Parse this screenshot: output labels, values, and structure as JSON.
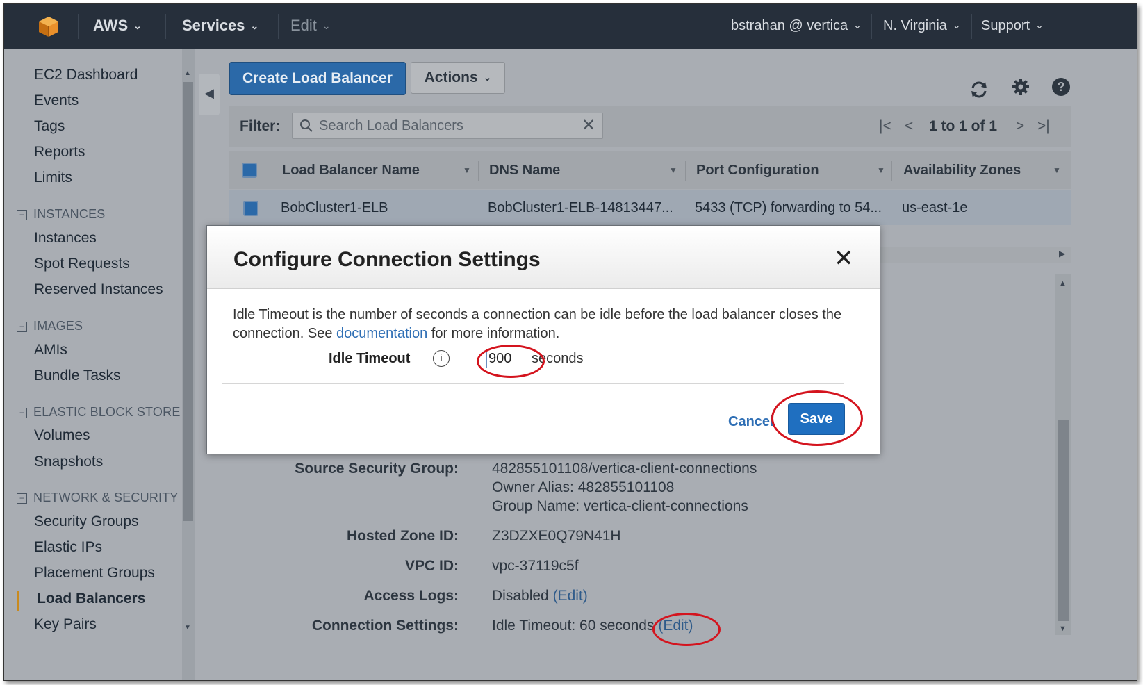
{
  "topnav": {
    "brand": "AWS",
    "services": "Services",
    "edit": "Edit",
    "account": "bstrahan @ vertica",
    "region": "N. Virginia",
    "support": "Support",
    "caret": "⌄"
  },
  "sidebar": {
    "links_top": [
      "EC2 Dashboard",
      "Events",
      "Tags",
      "Reports",
      "Limits"
    ],
    "sections": [
      {
        "title": "INSTANCES",
        "items": [
          "Instances",
          "Spot Requests",
          "Reserved Instances"
        ]
      },
      {
        "title": "IMAGES",
        "items": [
          "AMIs",
          "Bundle Tasks"
        ]
      },
      {
        "title": "ELASTIC BLOCK STORE",
        "items": [
          "Volumes",
          "Snapshots"
        ]
      },
      {
        "title": "NETWORK & SECURITY",
        "items": [
          "Security Groups",
          "Elastic IPs",
          "Placement Groups",
          "Load Balancers",
          "Key Pairs"
        ]
      }
    ],
    "active": "Load Balancers",
    "collapse_glyph": "−"
  },
  "toolbar": {
    "create_label": "Create Load Balancer",
    "actions_label": "Actions",
    "icons": [
      "refresh-icon",
      "gear-icon",
      "help-icon"
    ]
  },
  "filter": {
    "label": "Filter:",
    "placeholder": "Search Load Balancers",
    "pager_text": "1 to 1 of 1"
  },
  "table": {
    "columns": [
      "Load Balancer Name",
      "DNS Name",
      "Port Configuration",
      "Availability Zones"
    ],
    "rows": [
      {
        "name": "BobCluster1-ELB",
        "dns": "BobCluster1-ELB-14813447...",
        "port": "5433 (TCP) forwarding to 54...",
        "zones": "us-east-1e"
      }
    ]
  },
  "details": {
    "source_sg_label": "Source Security Group:",
    "source_sg_lines": [
      "482855101108/vertica-client-connections",
      "Owner Alias: 482855101108",
      "Group Name: vertica-client-connections"
    ],
    "hosted_zone_label": "Hosted Zone ID:",
    "hosted_zone_value": "Z3DZXE0Q79N41H",
    "vpc_label": "VPC ID:",
    "vpc_value": "vpc-37119c5f",
    "access_logs_label": "Access Logs:",
    "access_logs_value": "Disabled",
    "conn_label": "Connection Settings:",
    "conn_value": "Idle Timeout: 60 seconds",
    "edit_link": "(Edit)"
  },
  "modal": {
    "title": "Configure Connection Settings",
    "close": "✕",
    "text_before": "Idle Timeout is the number of seconds a connection can be idle before the load balancer closes the connection. See ",
    "doc_link": "documentation",
    "text_after": " for more information.",
    "field_label": "Idle Timeout",
    "info": "i",
    "value": "900",
    "unit": "seconds",
    "cancel": "Cancel",
    "save": "Save"
  },
  "colors": {
    "nav_bg": "#262f3b",
    "primary": "#2b69a8",
    "save": "#1f6fc0",
    "annotation": "#d4141e",
    "active_marker": "#c98a1f"
  }
}
